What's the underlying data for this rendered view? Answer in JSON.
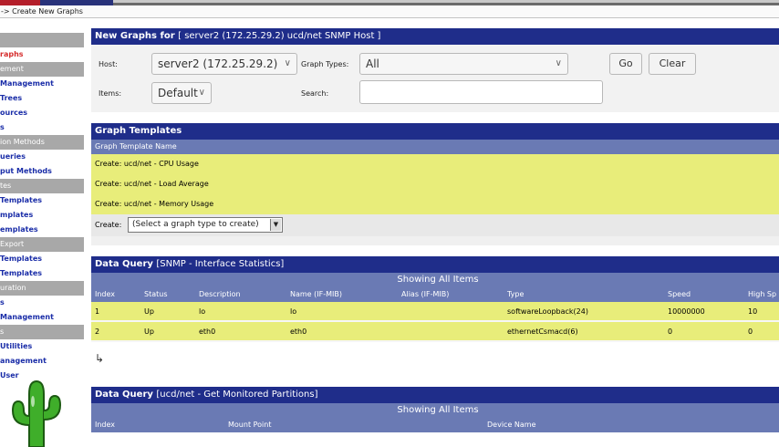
{
  "breadcrumb": "-> Create New Graphs",
  "sidebar": {
    "items": [
      {
        "label": "",
        "type": "blank"
      },
      {
        "label": "raphs",
        "type": "link",
        "selected": true
      },
      {
        "label": "ement",
        "type": "header"
      },
      {
        "label": "Management",
        "type": "link"
      },
      {
        "label": "Trees",
        "type": "link"
      },
      {
        "label": "ources",
        "type": "link"
      },
      {
        "label": "s",
        "type": "link"
      },
      {
        "label": "ion Methods",
        "type": "header"
      },
      {
        "label": "ueries",
        "type": "link"
      },
      {
        "label": "put Methods",
        "type": "link"
      },
      {
        "label": "tes",
        "type": "header"
      },
      {
        "label": "Templates",
        "type": "link"
      },
      {
        "label": "mplates",
        "type": "link"
      },
      {
        "label": "emplates",
        "type": "link"
      },
      {
        "label": "Export",
        "type": "header"
      },
      {
        "label": "Templates",
        "type": "link"
      },
      {
        "label": "Templates",
        "type": "link"
      },
      {
        "label": "uration",
        "type": "header"
      },
      {
        "label": "s",
        "type": "link"
      },
      {
        "label": "Management",
        "type": "link"
      },
      {
        "label": "s",
        "type": "header"
      },
      {
        "label": "Utilities",
        "type": "link"
      },
      {
        "label": "anagement",
        "type": "link"
      },
      {
        "label": "User",
        "type": "link"
      }
    ]
  },
  "new_graphs": {
    "title": "New Graphs for",
    "subtitle": "[ server2 (172.25.29.2) ucd/net SNMP Host ]",
    "host_label": "Host:",
    "host_value": "server2 (172.25.29.2)",
    "graph_types_label": "Graph Types:",
    "graph_types_value": "All",
    "items_label": "Items:",
    "items_value": "Default",
    "search_label": "Search:",
    "search_value": "",
    "go_label": "Go",
    "clear_label": "Clear"
  },
  "graph_templates": {
    "title": "Graph Templates",
    "column": "Graph Template Name",
    "rows": [
      "Create: ucd/net - CPU Usage",
      "Create: ucd/net - Load Average",
      "Create: ucd/net - Memory Usage"
    ],
    "create_label": "Create:",
    "create_select": "(Select a graph type to create)"
  },
  "dq_interfaces": {
    "title": "Data Query",
    "subtitle": "[SNMP - Interface Statistics]",
    "showing": "Showing All Items",
    "columns": [
      "Index",
      "Status",
      "Description",
      "Name (IF-MIB)",
      "Alias (IF-MIB)",
      "Type",
      "Speed",
      "High Sp"
    ],
    "rows": [
      [
        "1",
        "Up",
        "lo",
        "lo",
        "",
        "softwareLoopback(24)",
        "10000000",
        "10"
      ],
      [
        "2",
        "Up",
        "eth0",
        "eth0",
        "",
        "ethernetCsmacd(6)",
        "0",
        "0"
      ]
    ]
  },
  "dq_partitions": {
    "title": "Data Query",
    "subtitle": "[ucd/net - Get Monitored Partitions]",
    "showing": "Showing All Items",
    "columns": [
      "Index",
      "Mount Point",
      "Device Name"
    ]
  },
  "icons": {
    "select_chevron": "chevron-down-icon",
    "return_arrow": "return-arrow-icon",
    "logo": "cactus-logo"
  }
}
